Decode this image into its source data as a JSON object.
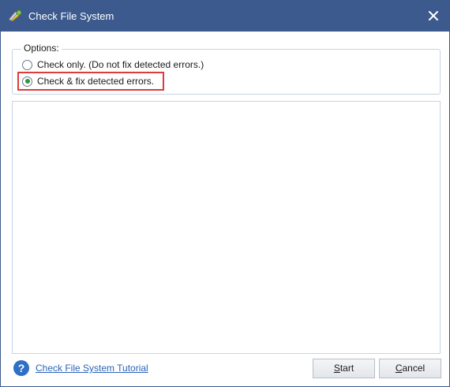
{
  "window": {
    "title": "Check File System",
    "icon": "wrench-pencil-icon",
    "titlebar_color": "#3c5a8e"
  },
  "options": {
    "legend": "Options:",
    "radios": [
      {
        "label": "Check only. (Do not fix detected errors.)",
        "checked": false
      },
      {
        "label": "Check & fix detected errors.",
        "checked": true
      }
    ],
    "highlight_color": "#e03b3b"
  },
  "footer": {
    "help_icon": "question-icon",
    "help_glyph": "?",
    "tutorial_link": "Check File System Tutorial",
    "start_prefix": "",
    "start_ul": "S",
    "start_rest": "tart",
    "cancel_prefix": "",
    "cancel_ul": "C",
    "cancel_rest": "ancel"
  }
}
